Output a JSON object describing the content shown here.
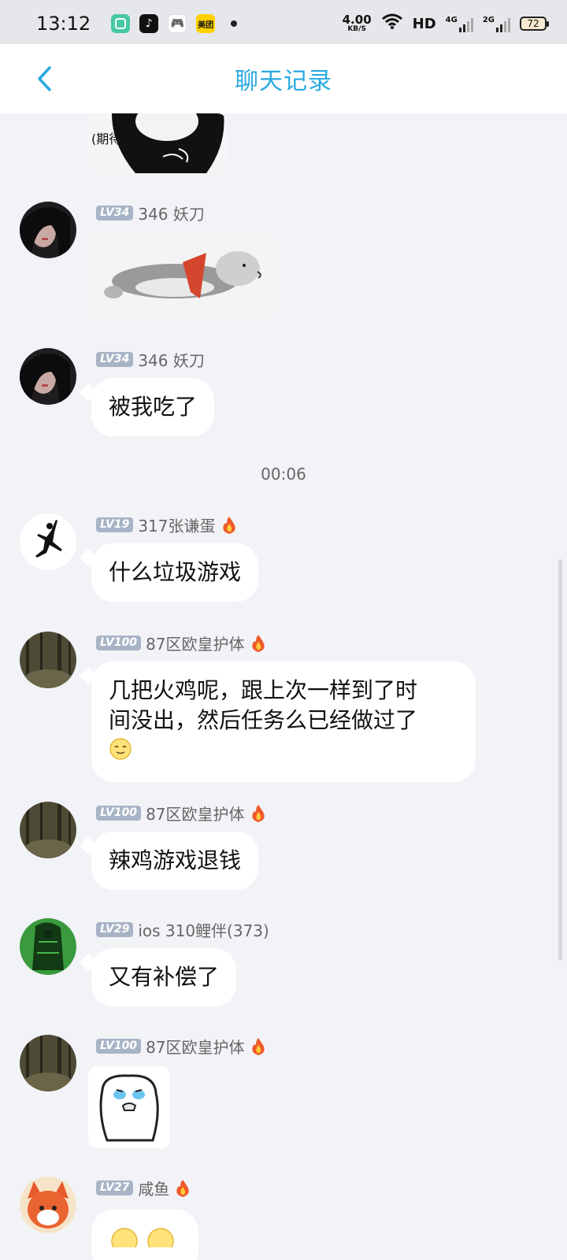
{
  "status_bar": {
    "time": "13:12",
    "apps": [
      "green-app-icon",
      "tiktok-icon",
      "game-icon",
      "meituan-icon"
    ],
    "meituan_label": "美团",
    "net_speed": "4.00",
    "net_unit": "KB/S",
    "hd_label": "HD",
    "sig1_label": "4G",
    "sig2_label": "2G",
    "battery": "72"
  },
  "header": {
    "title": "聊天记录"
  },
  "messages": [
    {
      "level": "LV34",
      "name": "346  妖刀",
      "type": "image",
      "image": "sleeping-dog-sticker"
    },
    {
      "level": "LV34",
      "name": "346  妖刀",
      "type": "text",
      "text": "被我吃了"
    },
    {
      "level": "LV19",
      "name": "317张谦蛋",
      "type": "text",
      "text": "什么垃圾游戏"
    },
    {
      "level": "LV100",
      "name": "87区欧皇护体",
      "type": "text",
      "text_line1": "几把火鸡呢，跟上次一样到了时",
      "text_line2": "间没出，然后任务么已经做过了"
    },
    {
      "level": "LV100",
      "name": "87区欧皇护体",
      "type": "text",
      "text": "辣鸡游戏退钱"
    },
    {
      "level": "LV29",
      "name": "ios 310鲤伴(373)",
      "type": "text",
      "text": "又有补偿了"
    },
    {
      "level": "LV100",
      "name": "87区欧皇护体",
      "type": "image",
      "image": "crying-bear-sticker"
    },
    {
      "level": "LV27",
      "name": "咸鱼",
      "type": "partial"
    }
  ],
  "timestamp": "00:06",
  "top_sticker_caption": "(期待)",
  "colors": {
    "accent": "#2aa9e0",
    "background": "#f2f3f7",
    "level_badge": "#a8b4c6"
  }
}
